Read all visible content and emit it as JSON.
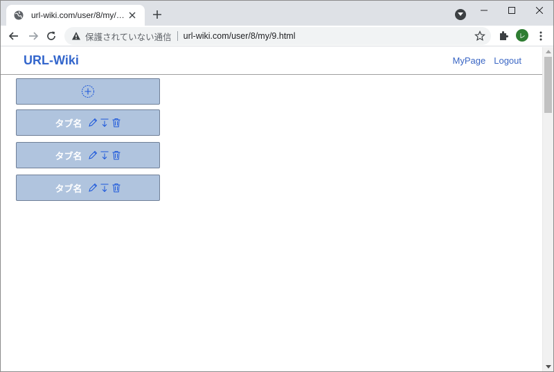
{
  "browser": {
    "tab_title": "url-wiki.com/user/8/my/9.html",
    "security_label": "保護されていない通信",
    "url": "url-wiki.com/user/8/my/9.html",
    "profile_initial": "レ",
    "accent_color": "#1a73e8"
  },
  "header": {
    "brand": "URL-Wiki",
    "nav": {
      "mypage": "MyPage",
      "logout": "Logout"
    }
  },
  "tabs": [
    {
      "label": "タブ名"
    },
    {
      "label": "タブ名"
    },
    {
      "label": "タブ名"
    }
  ],
  "colors": {
    "card_bg": "#b0c4de",
    "brand": "#3366cc",
    "icon_blue": "#1a56db"
  },
  "icons": {
    "add": "plus-circle-icon",
    "edit": "pencil-icon",
    "move": "move-down-icon",
    "delete": "trash-icon"
  }
}
